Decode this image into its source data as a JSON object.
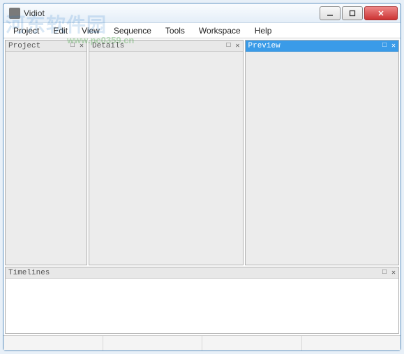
{
  "window": {
    "title": "Vidiot"
  },
  "menu": {
    "items": [
      "Project",
      "Edit",
      "View",
      "Sequence",
      "Tools",
      "Workspace",
      "Help"
    ]
  },
  "panels": {
    "project": {
      "title": "Project"
    },
    "details": {
      "title": "Details"
    },
    "preview": {
      "title": "Preview"
    },
    "timelines": {
      "title": "Timelines"
    }
  },
  "watermark": {
    "main": "河东软件园",
    "sub": "www.pc0359.cn"
  }
}
